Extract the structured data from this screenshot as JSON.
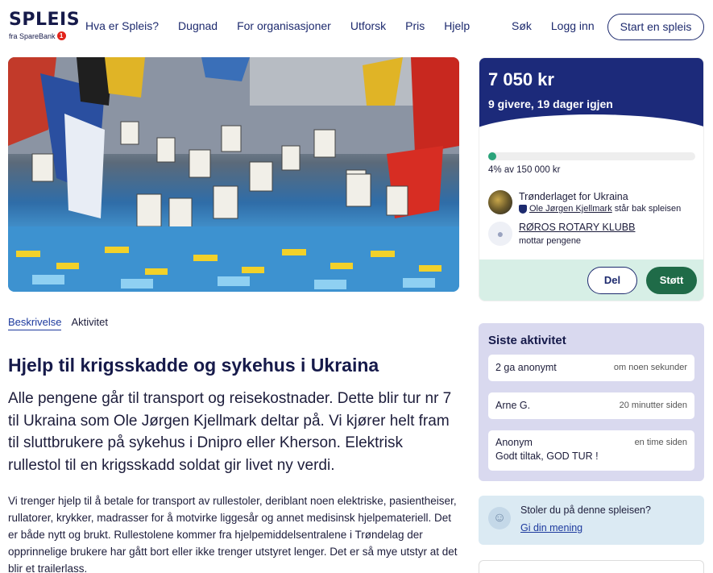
{
  "header": {
    "logo_text": "SPLEIS",
    "logo_sub": "fra SpareBank",
    "logo_badge": "1",
    "nav": [
      "Hva er Spleis?",
      "Dugnad",
      "For organisasjoner",
      "Utforsk",
      "Pris",
      "Hjelp"
    ],
    "search": "Søk",
    "login": "Logg inn",
    "start": "Start en spleis"
  },
  "tabs": {
    "description": "Beskrivelse",
    "activity": "Aktivitet"
  },
  "campaign": {
    "title": "Hjelp til krigsskadde og sykehus i Ukraina",
    "lead": "Alle pengene går til transport og reisekostnader. Dette blir tur nr 7 til Ukraina som Ole Jørgen Kjellmark deltar på. Vi kjører helt fram til sluttbrukere på sykehus i Dnipro eller Kherson. Elektrisk rullestol til en krigsskadd soldat gir livet ny verdi.",
    "body": "Vi trenger hjelp til å betale for transport av rullestoler, deriblant noen elektriske, pasientheiser, rullatorer, krykker, madrasser for å motvirke liggesår og annet medisinsk hjelpemateriell. Det er både nytt og brukt. Rullestolene kommer fra hjelpemiddelsentralene i Trøndelag der opprinnelige brukere har gått bort eller ikke trenger utstyret lenger. Det er så mye utstyr at det blir et trailerlass."
  },
  "summary": {
    "amount": "7 050 kr",
    "givers": "9 givere, 19 dager igjen",
    "progress_percent": 4,
    "goal": "4% av 150 000 kr",
    "organizer": "Trønderlaget for Ukraina",
    "organizer_person": "Ole Jørgen Kjellmark",
    "organizer_suffix": "står bak spleisen",
    "recipient": "RØROS ROTARY KLUBB",
    "recipient_sub": "mottar pengene",
    "share": "Del",
    "support": "Støtt"
  },
  "activity": {
    "title": "Siste aktivitet",
    "items": [
      {
        "name": "2 ga anonymt",
        "time": "om noen sekunder",
        "message": ""
      },
      {
        "name": "Arne G.",
        "time": "20 minutter siden",
        "message": ""
      },
      {
        "name": "Anonym",
        "time": "en time siden",
        "message": "Godt tiltak, GOD TUR !"
      }
    ]
  },
  "trust": {
    "question": "Stoler du på denne spleisen?",
    "link": "Gi din mening"
  },
  "colors": {
    "navy": "#1c2a7a",
    "green": "#1f6b48",
    "mint": "#d7efe6",
    "lavender": "#d9d9ef"
  }
}
